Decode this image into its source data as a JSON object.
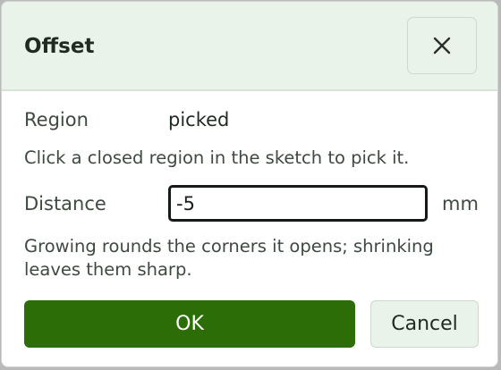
{
  "dialog": {
    "title": "Offset",
    "close_icon": "close-icon"
  },
  "region": {
    "label": "Region",
    "value": "picked",
    "hint": "Click a closed region in the sketch to pick it."
  },
  "distance": {
    "label": "Distance",
    "value": "-5",
    "unit": "mm",
    "hint": "Growing rounds the corners it opens; shrinking leaves them sharp."
  },
  "actions": {
    "ok_label": "OK",
    "cancel_label": "Cancel"
  },
  "colors": {
    "accent": "#2d6d07",
    "header_bg": "#e9f3ea"
  }
}
